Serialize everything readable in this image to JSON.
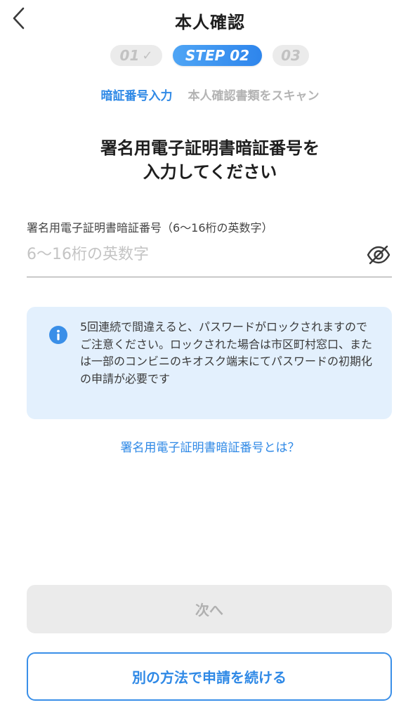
{
  "header": {
    "title": "本人確認"
  },
  "steps": {
    "done_label": "01",
    "active_label": "STEP 02",
    "todo_label": "03"
  },
  "substeps": {
    "active": "暗証番号入力",
    "inactive": "本人確認書類をスキャン"
  },
  "main": {
    "heading_line1": "署名用電子証明書暗証番号を",
    "heading_line2": "入力してください",
    "field": {
      "label": "署名用電子証明書暗証番号（6〜16桁の英数字）",
      "placeholder": "6〜16桁の英数字",
      "value": ""
    },
    "notice": {
      "text": "5回連続で間違えると、パスワードがロックされますのでご注意ください。ロックされた場合は市区町村窓口、または一部のコンビニのキオスク端末にてパスワードの初期化の申請が必要です"
    },
    "help_link": "署名用電子証明書暗証番号とは？"
  },
  "buttons": {
    "next_label": "次へ",
    "alt_label": "別の方法で申請を続ける"
  },
  "icons": {
    "back": "chevron-left-icon",
    "step_done": "check-icon",
    "visibility": "eye-off-icon",
    "info": "info-icon"
  },
  "colors": {
    "accent": "#2f89e6",
    "step_active_start": "#4fa5f5",
    "step_active_end": "#2e85ec",
    "notice_bg": "#e3f0fd",
    "disabled_bg": "#ebebeb",
    "disabled_text": "#b0b0b0"
  }
}
